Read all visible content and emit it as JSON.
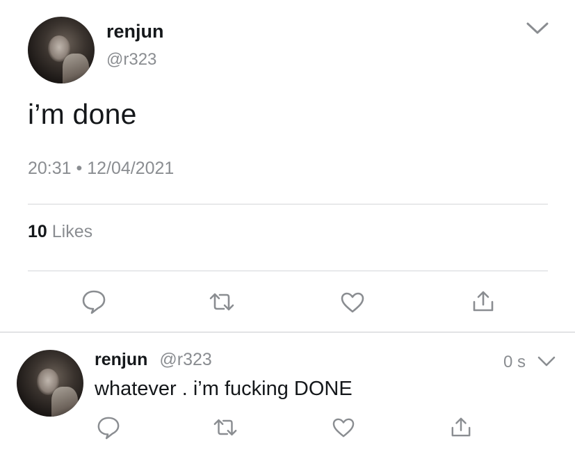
{
  "main_tweet": {
    "display_name": "renjun",
    "handle": "@r323",
    "text": "i’m done",
    "timestamp": "20:31 • 12/04/2021",
    "likes_count": "10",
    "likes_label": "Likes"
  },
  "reply": {
    "display_name": "renjun",
    "handle": "@r323",
    "time_ago": "0 s",
    "text": "whatever . i’m fucking DONE"
  },
  "colors": {
    "icon": "#8a8d91",
    "divider": "#d4d6d9",
    "text": "#14171a",
    "secondary": "#8a8d91"
  },
  "icons": [
    "reply-icon",
    "retweet-icon",
    "like-icon",
    "share-icon",
    "chevron-down-icon"
  ]
}
